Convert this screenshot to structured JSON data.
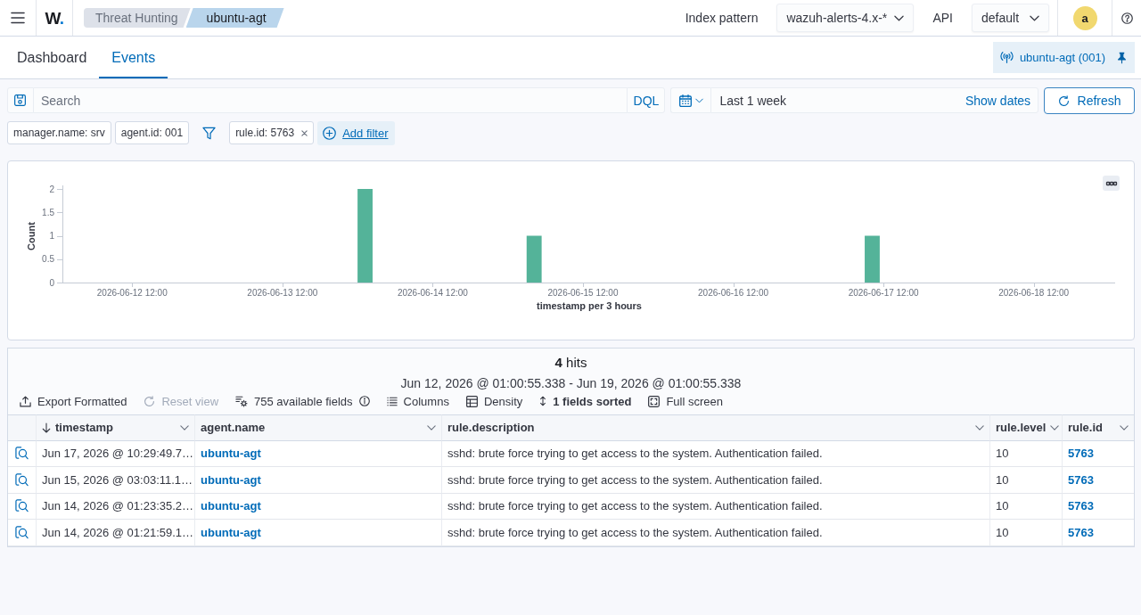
{
  "header": {
    "logo": "W.",
    "breadcrumbs": [
      {
        "label": "Threat Hunting",
        "selected": false
      },
      {
        "label": "ubuntu-agt",
        "selected": true
      }
    ],
    "index_pattern": {
      "label": "Index pattern",
      "value": "wazuh-alerts-4.x-*"
    },
    "api": {
      "label": "API",
      "value": "default"
    },
    "avatar": "a"
  },
  "tabs": [
    {
      "label": "Dashboard",
      "selected": false
    },
    {
      "label": "Events",
      "selected": true
    }
  ],
  "agent": {
    "label": "ubuntu-agt (001)",
    "pinned": true
  },
  "search": {
    "placeholder": "Search",
    "language": "DQL"
  },
  "date_picker": {
    "value": "Last 1 week",
    "show_dates": "Show dates",
    "refresh": "Refresh"
  },
  "filters": {
    "fixed": [
      "manager.name: srv",
      "agent.id: 001"
    ],
    "items": [
      {
        "label": "rule.id: 5763",
        "removable": true
      }
    ],
    "add": "Add filter"
  },
  "chart": {
    "chart_data": {
      "type": "bar",
      "xlabel": "timestamp per 3 hours",
      "ylabel": "Count",
      "x": [
        "2026-06-14 00:00",
        "2026-06-15 03:00",
        "2026-06-17 09:00"
      ],
      "values": [
        2,
        1,
        1
      ],
      "xlim": [
        "2026-06-12 01:00",
        "2026-06-19 01:00"
      ],
      "ylim": [
        0,
        2
      ],
      "xticks": [
        {
          "value": "2026-06-12 12:00",
          "label": "2026-06-12 12:00"
        },
        {
          "value": "2026-06-13 12:00",
          "label": "2026-06-13 12:00"
        },
        {
          "value": "2026-06-14 12:00",
          "label": "2026-06-14 12:00"
        },
        {
          "value": "2026-06-15 12:00",
          "label": "2026-06-15 12:00"
        },
        {
          "value": "2026-06-16 12:00",
          "label": "2026-06-16 12:00"
        },
        {
          "value": "2026-06-17 12:00",
          "label": "2026-06-17 12:00"
        },
        {
          "value": "2026-06-18 12:00",
          "label": "2026-06-18 12:00"
        }
      ],
      "yticks": [
        0,
        0.5,
        1,
        1.5,
        2
      ]
    }
  },
  "results": {
    "hits": "**4** hits",
    "time_range": "Jun 12, 2026 @ 01:00:55.338 - Jun 19, 2026 @ 01:00:55.338",
    "toolbar": [
      {
        "label": "Export Formatted",
        "disabled": false,
        "active": false
      },
      {
        "label": "Reset view",
        "disabled": true,
        "active": false
      },
      {
        "label": "755 available fields",
        "disabled": false,
        "active": false
      },
      {
        "label": "Columns",
        "disabled": false,
        "active": false
      },
      {
        "label": "Density",
        "disabled": false,
        "active": false
      },
      {
        "label": "1 fields sorted",
        "disabled": false,
        "active": true
      },
      {
        "label": "Full screen",
        "disabled": false,
        "active": false
      }
    ],
    "table": {
      "columns": [
        {
          "label": "timestamp",
          "kind": "text",
          "sorted": true
        },
        {
          "label": "agent.name",
          "kind": "link",
          "sorted": false
        },
        {
          "label": "rule.description",
          "kind": "text",
          "sorted": false
        },
        {
          "label": "rule.level",
          "kind": "text",
          "sorted": false
        },
        {
          "label": "rule.id",
          "kind": "link",
          "sorted": false
        }
      ],
      "rows": [
        {
          "cells": [
            "Jun 17, 2026 @ 10:29:49.7…",
            "ubuntu-agt",
            "sshd: brute force trying to get access to the system. Authentication failed.",
            "10",
            "5763"
          ]
        },
        {
          "cells": [
            "Jun 15, 2026 @ 03:03:11.1…",
            "ubuntu-agt",
            "sshd: brute force trying to get access to the system. Authentication failed.",
            "10",
            "5763"
          ]
        },
        {
          "cells": [
            "Jun 14, 2026 @ 01:23:35.2…",
            "ubuntu-agt",
            "sshd: brute force trying to get access to the system. Authentication failed.",
            "10",
            "5763"
          ]
        },
        {
          "cells": [
            "Jun 14, 2026 @ 01:21:59.1…",
            "ubuntu-agt",
            "sshd: brute force trying to get access to the system. Authentication failed.",
            "10",
            "5763"
          ]
        }
      ]
    }
  }
}
